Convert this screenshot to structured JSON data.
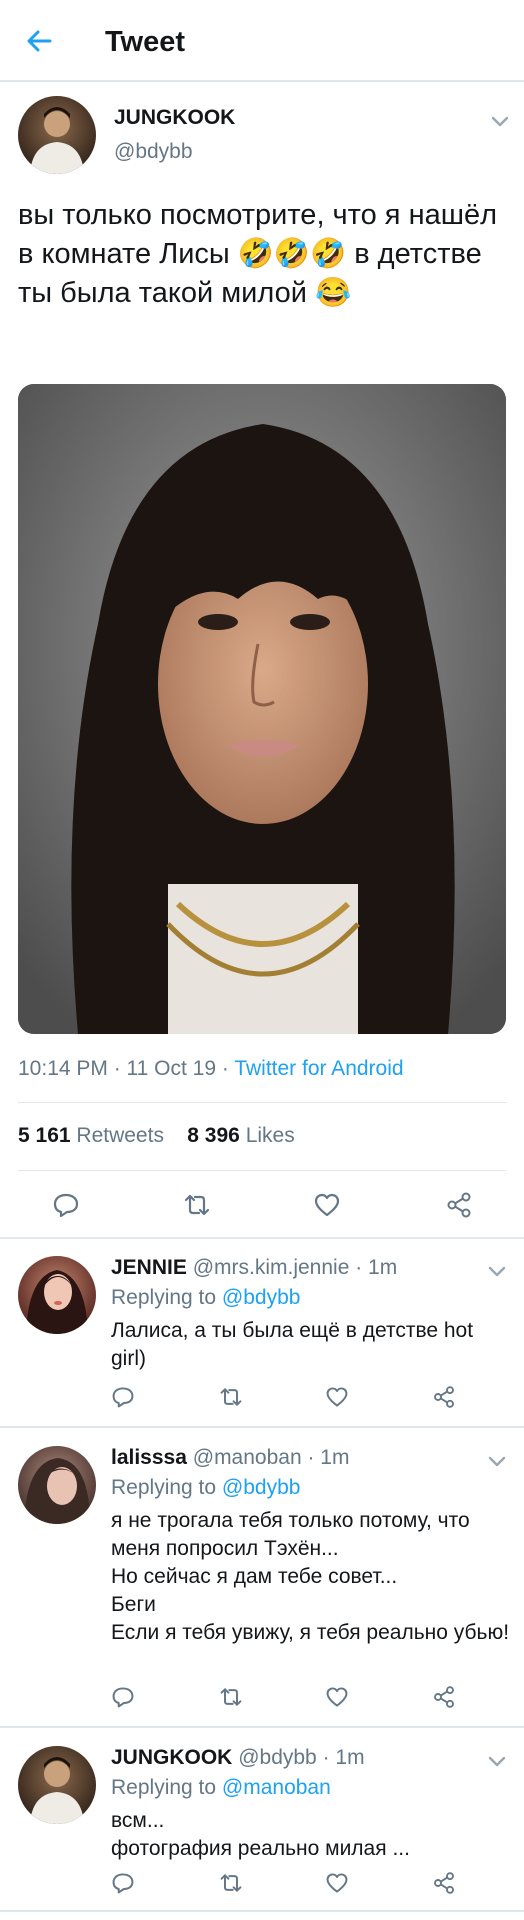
{
  "header": {
    "title": "Tweet"
  },
  "main_tweet": {
    "author_name": "JUNGKOOK",
    "author_handle": "@bdybb",
    "text": "вы только посмотрите, что я нашёл в комнате Лисы 🤣🤣🤣 в детстве ты была такой милой 😂",
    "media_description": "",
    "time": "10:14 PM · 11 Oct 19 · ",
    "client": "Twitter for Android",
    "retweet_count": "5 161",
    "retweet_label": "Retweets",
    "like_count": "8 396",
    "like_label": "Likes",
    "actions": [
      "reply-icon",
      "retweet-icon",
      "like-icon",
      "share-icon"
    ]
  },
  "replies": [
    {
      "name": "JENNIE",
      "handle": "@mrs.kim.jennie · 1m",
      "replying_prefix": "Replying to ",
      "replying_to": "@bdybb",
      "text": "Лалиса, а ты была ещё в детстве hot girl)"
    },
    {
      "name": "lalisssa",
      "handle": "@manoban · 1m",
      "replying_prefix": "Replying to ",
      "replying_to": "@bdybb",
      "text": "я не трогала тебя только потому, что меня попросил Тэхён...\nНо сейчас я дам тебе совет...\nБеги\nЕсли я тебя увижу, я тебя реально убью!"
    },
    {
      "name": "JUNGKOOK",
      "handle": "@bdybb · 1m",
      "replying_prefix": "Replying to ",
      "replying_to": "@manoban",
      "text": "всм...\nфотография реально милая ..."
    }
  ],
  "colors": {
    "accent": "#1da1f2",
    "muted": "#657786",
    "text": "#14171a",
    "divider": "#e1e8ed"
  }
}
